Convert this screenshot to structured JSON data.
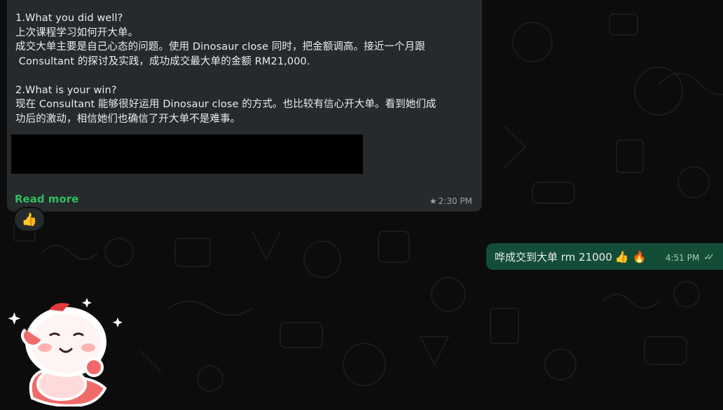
{
  "incoming_message": {
    "text": "1.What you did well?\n上次课程学习如何开大单。\n成交大单主要是自己心态的问题。使用 Dinosaur close 同时，把金额调高。接近一个月跟\n Consultant 的探讨及实践，成功成交最大单的金额 RM21,000.\n\n2.What is your win?\n现在 Consultant 能够很好运用 Dinosaur close 的方式。也比较有信心开大单。看到她们成\n功后的激动，相信她们也确信了开大单不是难事。",
    "read_more_label": "Read more",
    "starred_icon": "★",
    "time": "2:30 PM",
    "reaction": "👍"
  },
  "outgoing_message": {
    "text": "哗成交到大单 rm 21000",
    "emojis": "👍 🔥",
    "time": "4:51 PM",
    "status_icon": "✓✓"
  },
  "sticker": {
    "icon": "cartoon-character-sticker"
  },
  "colors": {
    "background": "#0c0c0c",
    "incoming_bubble": "#262a2c",
    "outgoing_bubble": "#144d37",
    "read_more": "#2fbe5f"
  }
}
